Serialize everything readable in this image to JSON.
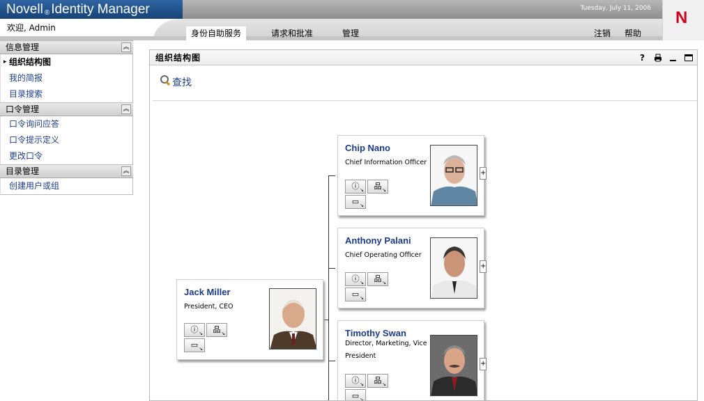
{
  "header": {
    "brand_pre": "Novell",
    "brand_reg": "®",
    "brand_post": "Identity Manager",
    "date": "Tuesday, July 11, 2006",
    "logo_letter": "N",
    "welcome": "欢迎, Admin",
    "nav": [
      {
        "label": "身份自助服务",
        "active": true
      },
      {
        "label": "请求和批准"
      },
      {
        "label": "管理"
      }
    ],
    "logout": "注销",
    "help": "帮助"
  },
  "sidebar": {
    "sections": [
      {
        "title": "信息管理",
        "items": [
          "组织结构图",
          "我的简报",
          "目录搜索"
        ]
      },
      {
        "title": "口令管理",
        "items": [
          "口令询问应答",
          "口令提示定义",
          "更改口令"
        ]
      },
      {
        "title": "目录管理",
        "items": [
          "创建用户或组"
        ]
      }
    ],
    "current_item": "组织结构图"
  },
  "portlet": {
    "title": "组织结构图",
    "find": "查找",
    "tools": [
      "help-icon",
      "print-icon",
      "minimize-icon",
      "maximize-icon"
    ]
  },
  "orgchart": {
    "root": {
      "name": "Jack Miller",
      "title": "President, CEO"
    },
    "reports": [
      {
        "name": "Chip Nano",
        "title": "Chief Information Officer"
      },
      {
        "name": "Anthony Palani",
        "title": "Chief Operating Officer"
      },
      {
        "name": "Timothy Swan",
        "title": "Director, Marketing, Vice President"
      }
    ],
    "expand_label": "+"
  },
  "colors": {
    "brand_blue": "#1d4e86",
    "link_blue": "#1d3e8a",
    "name_blue": "#1a3a8c",
    "logo_red": "#d0021b"
  }
}
